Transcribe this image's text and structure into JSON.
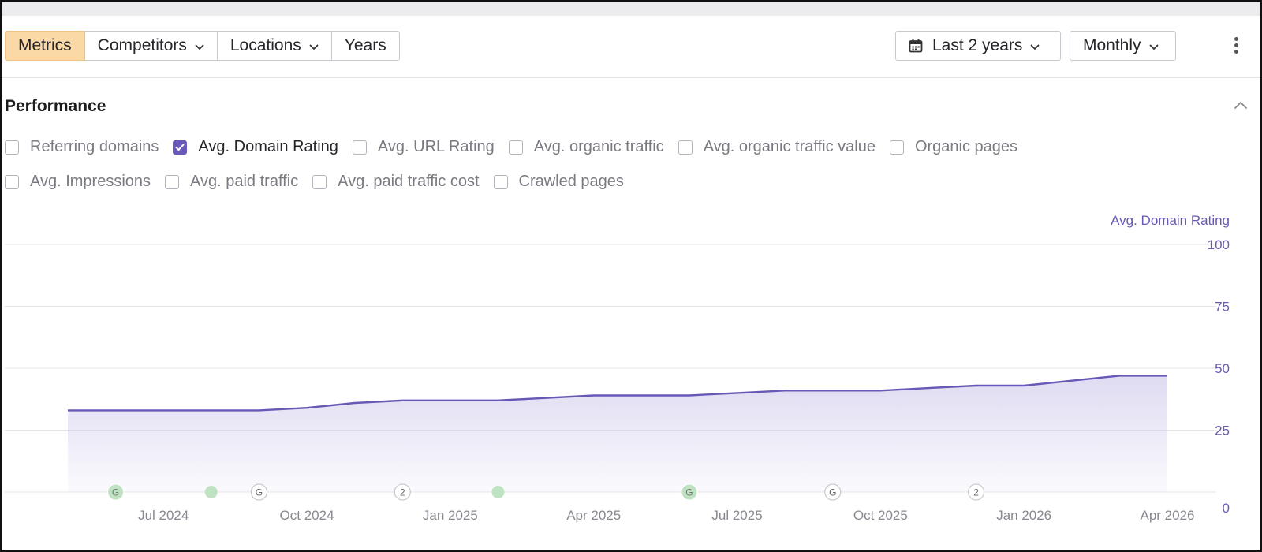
{
  "toolbar": {
    "tabs": [
      {
        "label": "Metrics",
        "active": true,
        "has_dropdown": false
      },
      {
        "label": "Competitors",
        "active": false,
        "has_dropdown": true
      },
      {
        "label": "Locations",
        "active": false,
        "has_dropdown": true
      },
      {
        "label": "Years",
        "active": false,
        "has_dropdown": false
      }
    ],
    "range_label": "Last 2 years",
    "interval_label": "Monthly",
    "icons": [
      "calendar-icon",
      "chevron-down-icon",
      "more-vertical-icon",
      "chevron-up-icon"
    ]
  },
  "performance": {
    "title": "Performance",
    "metrics_row1": [
      {
        "label": "Referring domains",
        "checked": false
      },
      {
        "label": "Avg. Domain Rating",
        "checked": true
      },
      {
        "label": "Avg. URL Rating",
        "checked": false
      },
      {
        "label": "Avg. organic traffic",
        "checked": false
      },
      {
        "label": "Avg. organic traffic value",
        "checked": false
      },
      {
        "label": "Organic pages",
        "checked": false
      }
    ],
    "metrics_row2": [
      {
        "label": "Avg. Impressions",
        "checked": false
      },
      {
        "label": "Avg. paid traffic",
        "checked": false
      },
      {
        "label": "Avg. paid traffic cost",
        "checked": false
      },
      {
        "label": "Crawled pages",
        "checked": false
      }
    ]
  },
  "colors": {
    "accent": "#6a58b6",
    "active_tab": "#fbd9a6",
    "marker_green": "#5cb86c",
    "axis_text": "#6a58b6"
  },
  "chart_data": {
    "type": "area",
    "series": [
      {
        "name": "Avg. Domain Rating",
        "x": [
          "2024-05",
          "2024-06",
          "2024-07",
          "2024-08",
          "2024-09",
          "2024-10",
          "2024-11",
          "2024-12",
          "2025-01",
          "2025-02",
          "2025-03",
          "2025-04",
          "2025-05",
          "2025-06",
          "2025-07",
          "2025-08",
          "2025-09",
          "2025-10",
          "2025-11",
          "2025-12",
          "2026-01",
          "2026-02",
          "2026-03",
          "2026-04"
        ],
        "values": [
          33,
          33,
          33,
          33,
          33,
          34,
          36,
          37,
          37,
          37,
          38,
          39,
          39,
          39,
          40,
          41,
          41,
          41,
          42,
          43,
          43,
          45,
          47,
          47
        ]
      }
    ],
    "y_axis_title": "Avg. Domain Rating",
    "y_ticks": [
      0,
      25,
      50,
      75,
      100
    ],
    "ylim": [
      0,
      100
    ],
    "x_tick_labels": [
      "Jul 2024",
      "Oct 2024",
      "Jan 2025",
      "Apr 2025",
      "Jul 2025",
      "Oct 2025",
      "Jan 2026",
      "Apr 2026"
    ],
    "x_tick_months": [
      "2024-07",
      "2024-10",
      "2025-01",
      "2025-04",
      "2025-07",
      "2025-10",
      "2026-01",
      "2026-04"
    ],
    "grid": true,
    "event_markers": [
      {
        "month": 2024.375,
        "type": "G"
      },
      {
        "month": 2024.542,
        "type": "dot"
      },
      {
        "month": 2024.708,
        "type": "2"
      },
      {
        "month": 2024.875,
        "type": "dot"
      },
      {
        "month": 2025.042,
        "type": "a"
      },
      {
        "month": 2025.208,
        "type": "G"
      },
      {
        "month": 2025.375,
        "type": "2"
      },
      {
        "month": 2025.542,
        "type": "big"
      },
      {
        "month": 2025.708,
        "type": "dot"
      },
      {
        "month": 2025.875,
        "type": "G"
      },
      {
        "month": 2026.042,
        "type": "dot"
      },
      {
        "month": 2026.208,
        "type": "dot"
      },
      {
        "month": 2026.375,
        "type": "G"
      },
      {
        "month": 2026.542,
        "type": "dot"
      },
      {
        "month": 2026.708,
        "type": "G"
      },
      {
        "month": 2026.875,
        "type": "2"
      },
      {
        "month": 2027.042,
        "type": "dot"
      },
      {
        "month": 2027.375,
        "type": "G"
      },
      {
        "month": 2027.708,
        "type": "G"
      },
      {
        "month": 2027.875,
        "type": "2"
      }
    ]
  }
}
